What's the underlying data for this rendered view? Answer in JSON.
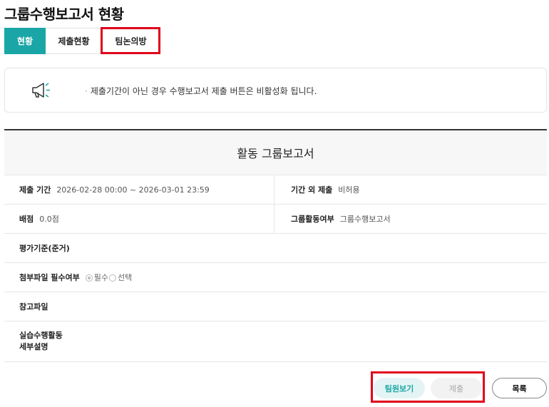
{
  "page": {
    "title": "그룹수행보고서 현황"
  },
  "tabs": [
    {
      "label": "현황",
      "active": true
    },
    {
      "label": "제출현황",
      "active": false
    },
    {
      "label": "팀논의방",
      "active": false
    }
  ],
  "notice": {
    "icon": "megaphone-icon",
    "text": "제출기간이 아닌 경우 수행보고서 제출 버튼은 비활성화 됩니다."
  },
  "report": {
    "title": "활동 그룹보고서",
    "submit_period": {
      "label": "제출 기간",
      "value": "2026-02-28 00:00 ~ 2026-03-01 23:59"
    },
    "late_submit": {
      "label": "기간 외 제출",
      "value": "비허용"
    },
    "score": {
      "label": "배점",
      "value": "0.0점"
    },
    "group_activity": {
      "label": "그룹활동여부",
      "value": "그룹수행보고서"
    },
    "criteria": {
      "label": "평가기준(준거)",
      "value": ""
    },
    "attachment_required": {
      "label": "첨부파일 필수여부",
      "options": [
        "필수",
        "선택"
      ],
      "selected": "필수"
    },
    "reference_file": {
      "label": "참고파일",
      "value": ""
    },
    "description": {
      "label_line1": "실습수행활동",
      "label_line2": "세부설명",
      "value": ""
    }
  },
  "buttons": {
    "members": "팀원보기",
    "submit": "제출",
    "list": "목록"
  },
  "colors": {
    "accent": "#1aa6a6",
    "highlight": "#e0001b"
  }
}
